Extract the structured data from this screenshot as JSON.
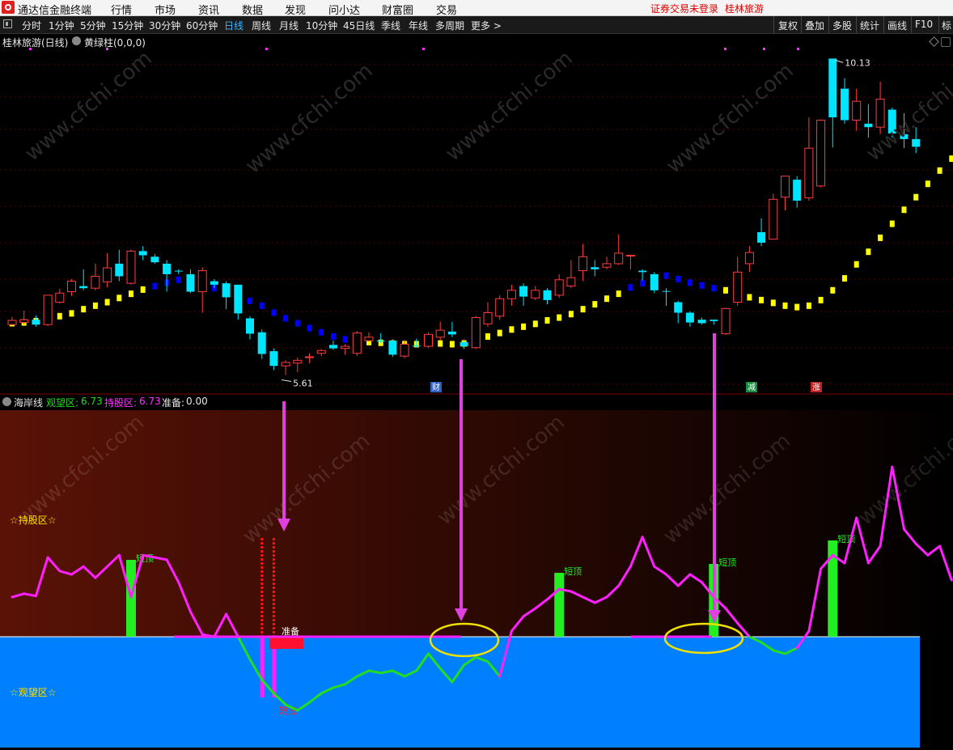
{
  "titlebar": {
    "app_name": "通达信金融终端",
    "menus": [
      "行情",
      "市场",
      "资讯",
      "数据",
      "发现",
      "问小达",
      "财富圈",
      "交易"
    ],
    "status_warning": "证券交易未登录",
    "stock": "桂林旅游"
  },
  "toolbar": {
    "periods": [
      "分时",
      "1分钟",
      "5分钟",
      "15分钟",
      "30分钟",
      "60分钟",
      "日线",
      "周线",
      "月线",
      "10分钟",
      "45日线",
      "季线",
      "年线",
      "多周期",
      "更多 >"
    ],
    "active_period": "日线",
    "right_buttons": [
      "复权",
      "叠加",
      "多股",
      "统计",
      "画线",
      "F10",
      "标"
    ]
  },
  "main_chart": {
    "title": "桂林旅游(日线)",
    "indicator": "黄绿柱(0,0,0)",
    "high_label": "10.13",
    "low_label": "5.61",
    "event_markers": [
      "财",
      "减",
      "涨"
    ]
  },
  "sub_chart": {
    "indicator_name": "海岸线",
    "watch_label": "观望区:",
    "watch_value": "6.73",
    "hold_label": "持股区:",
    "hold_value": "6.73",
    "ready_label": "准备:",
    "ready_value": "0.00",
    "zone_hold": "☆持股区☆",
    "zone_watch": "☆观望区☆",
    "short_top_labels": [
      "短顶",
      "短顶",
      "短顶",
      "短顶"
    ],
    "short_bottom_label": "短底",
    "ready_marker": "准备"
  },
  "chart_data": {
    "type": "candlestick",
    "candles": [
      [
        6.33,
        6.39,
        6.44,
        6.32
      ],
      [
        6.36,
        6.4,
        6.53,
        6.33
      ],
      [
        6.4,
        6.33,
        6.46,
        6.3
      ],
      [
        6.33,
        6.75,
        6.75,
        6.31
      ],
      [
        6.65,
        6.78,
        6.84,
        6.63
      ],
      [
        6.8,
        6.95,
        6.98,
        6.74
      ],
      [
        6.88,
        6.85,
        7.12,
        6.82
      ],
      [
        6.85,
        7.02,
        7.2,
        6.82
      ],
      [
        6.94,
        7.14,
        7.35,
        6.86
      ],
      [
        7.2,
        7.02,
        7.4,
        6.95
      ],
      [
        6.92,
        7.38,
        7.4,
        6.9
      ],
      [
        7.38,
        7.32,
        7.45,
        7.25
      ],
      [
        7.3,
        7.22,
        7.34,
        7.2
      ],
      [
        7.2,
        7.05,
        7.25,
        6.8
      ],
      [
        7.1,
        7.09,
        7.12,
        7.05
      ],
      [
        7.05,
        6.8,
        7.12,
        6.78
      ],
      [
        6.8,
        7.1,
        7.15,
        6.5
      ],
      [
        6.95,
        6.9,
        6.98,
        6.85
      ],
      [
        6.92,
        6.72,
        6.95,
        6.55
      ],
      [
        6.9,
        6.49,
        6.9,
        6.4
      ],
      [
        6.42,
        6.2,
        6.45,
        6.12
      ],
      [
        6.22,
        5.91,
        6.26,
        5.84
      ],
      [
        5.95,
        5.74,
        5.99,
        5.68
      ],
      [
        5.74,
        5.79,
        5.82,
        5.61
      ],
      [
        5.78,
        5.82,
        5.86,
        5.65
      ],
      [
        5.86,
        5.87,
        5.92,
        5.78
      ],
      [
        5.92,
        5.96,
        5.98,
        5.88
      ],
      [
        6.04,
        5.99,
        6.1,
        5.97
      ],
      [
        5.99,
        6.02,
        6.05,
        5.9
      ],
      [
        5.92,
        6.21,
        6.24,
        5.88
      ],
      [
        6.1,
        6.15,
        6.22,
        6.09
      ],
      [
        6.1,
        6.09,
        6.21,
        6.06
      ],
      [
        6.1,
        5.9,
        6.12,
        5.87
      ],
      [
        5.88,
        6.05,
        6.11,
        5.85
      ],
      [
        6.03,
        6.02,
        6.13,
        6.0
      ],
      [
        6.02,
        6.19,
        6.22,
        6.0
      ],
      [
        6.15,
        6.25,
        6.37,
        6.1
      ],
      [
        6.23,
        6.19,
        6.37,
        6.15
      ],
      [
        6.08,
        6.02,
        6.12,
        5.98
      ],
      [
        6.0,
        6.43,
        6.45,
        5.98
      ],
      [
        6.34,
        6.5,
        6.65,
        6.3
      ],
      [
        6.45,
        6.7,
        6.75,
        6.4
      ],
      [
        6.7,
        6.82,
        6.9,
        6.6
      ],
      [
        6.88,
        6.73,
        6.92,
        6.6
      ],
      [
        6.71,
        6.82,
        6.88,
        6.68
      ],
      [
        6.82,
        6.68,
        6.85,
        6.62
      ],
      [
        6.75,
        6.97,
        7.05,
        6.71
      ],
      [
        6.88,
        7.0,
        7.25,
        6.85
      ],
      [
        7.1,
        7.3,
        7.48,
        6.95
      ],
      [
        7.15,
        7.12,
        7.25,
        7.02
      ],
      [
        7.15,
        7.2,
        7.3,
        7.12
      ],
      [
        7.2,
        7.35,
        7.62,
        7.18
      ],
      [
        7.31,
        7.32,
        7.32,
        7.12
      ],
      [
        7.1,
        7.08,
        7.12,
        6.96
      ],
      [
        7.05,
        6.82,
        7.08,
        6.78
      ],
      [
        6.81,
        6.8,
        6.85,
        6.6
      ],
      [
        6.65,
        6.5,
        6.67,
        6.35
      ],
      [
        6.5,
        6.36,
        6.52,
        6.3
      ],
      [
        6.4,
        6.35,
        6.43,
        6.33
      ],
      [
        6.4,
        6.38,
        6.4,
        6.33
      ],
      [
        6.2,
        6.56,
        6.57,
        6.18
      ],
      [
        6.65,
        7.08,
        7.3,
        6.6
      ],
      [
        7.2,
        7.36,
        7.45,
        7.08
      ],
      [
        7.65,
        7.5,
        7.85,
        7.45
      ],
      [
        7.55,
        8.12,
        8.2,
        7.55
      ],
      [
        8.15,
        8.45,
        8.45,
        7.96
      ],
      [
        8.4,
        8.1,
        8.45,
        8.0
      ],
      [
        8.14,
        8.85,
        9.29,
        8.1
      ],
      [
        8.31,
        9.25,
        9.26,
        8.29
      ],
      [
        10.13,
        9.29,
        10.13,
        8.86
      ],
      [
        9.7,
        9.25,
        9.85,
        9.2
      ],
      [
        9.25,
        9.52,
        9.7,
        9.1
      ],
      [
        9.2,
        9.15,
        9.48,
        9.0
      ],
      [
        9.15,
        9.55,
        9.8,
        9.05
      ],
      [
        9.4,
        9.06,
        9.43,
        9.0
      ],
      [
        9.05,
        8.98,
        9.35,
        8.85
      ],
      [
        8.98,
        8.87,
        9.15,
        8.78
      ]
    ],
    "stop_line": [
      6.35,
      6.36,
      6.38,
      6.41,
      6.45,
      6.49,
      6.55,
      6.6,
      6.65,
      6.71,
      6.77,
      6.83,
      6.88,
      6.93,
      6.97,
      6.94,
      6.9,
      6.85,
      6.8,
      6.74,
      6.67,
      6.6,
      6.5,
      6.42,
      6.35,
      6.28,
      6.22,
      6.16,
      6.12,
      6.1,
      6.08,
      6.07,
      6.06,
      6.05,
      6.05,
      6.06,
      6.06,
      6.05,
      6.06,
      6.1,
      6.16,
      6.21,
      6.26,
      6.3,
      6.34,
      6.39,
      6.43,
      6.48,
      6.55,
      6.62,
      6.7,
      6.77,
      6.86,
      6.92,
      7.0,
      7.03,
      6.98,
      6.93,
      6.89,
      6.85,
      6.82,
      6.77,
      6.72,
      6.68,
      6.64,
      6.6,
      6.58,
      6.6,
      6.68,
      6.82,
      6.99,
      7.19,
      7.37,
      7.57,
      7.77,
      7.97,
      8.15,
      8.34,
      8.53,
      8.7
    ],
    "stop_line_up": [
      true,
      true,
      true,
      true,
      true,
      true,
      true,
      true,
      true,
      true,
      true,
      true,
      false,
      false,
      false,
      false,
      false,
      false,
      false,
      false,
      false,
      false,
      false,
      false,
      false,
      false,
      false,
      false,
      false,
      true,
      true,
      true,
      true,
      true,
      true,
      true,
      true,
      true,
      true,
      true,
      true,
      true,
      true,
      true,
      true,
      true,
      true,
      true,
      true,
      true,
      true,
      true,
      false,
      false,
      false,
      false,
      false,
      false,
      false,
      false,
      true,
      true,
      true,
      true,
      true,
      true,
      true,
      true,
      true,
      true,
      true,
      true,
      true,
      true,
      true,
      true,
      true,
      true,
      true,
      true
    ],
    "oscillator": [
      0.35,
      0.38,
      0.36,
      0.7,
      0.58,
      0.55,
      0.62,
      0.52,
      0.62,
      0.72,
      0.35,
      0.72,
      0.7,
      0.68,
      0.48,
      0.22,
      0.02,
      0.0,
      0.2,
      0.0,
      -0.2,
      -0.38,
      -0.5,
      -0.6,
      -0.65,
      -0.58,
      -0.5,
      -0.45,
      -0.42,
      -0.35,
      -0.3,
      -0.32,
      -0.3,
      -0.35,
      -0.3,
      -0.15,
      -0.28,
      -0.4,
      -0.25,
      -0.18,
      -0.22,
      -0.35,
      0.05,
      0.18,
      0.25,
      0.33,
      0.42,
      0.4,
      0.35,
      0.3,
      0.35,
      0.45,
      0.62,
      0.88,
      0.62,
      0.55,
      0.45,
      0.55,
      0.48,
      0.35,
      0.25,
      0.12,
      0.0,
      -0.05,
      -0.12,
      -0.15,
      -0.1,
      0.05,
      0.6,
      0.72,
      0.65,
      1.05,
      0.65,
      0.8,
      1.5,
      0.95,
      0.82,
      0.72,
      0.8,
      0.5
    ],
    "short_tops": [
      10,
      46,
      59,
      69
    ],
    "bottom_bars": [
      21,
      22
    ]
  },
  "colors": {
    "up": "#ff3c3c",
    "down": "#00e5ff",
    "stop_up": "#ffff00",
    "stop_down": "#0000ff",
    "osc_hold": "#ff20ff",
    "osc_watch": "#22dd22",
    "top_bar": "#22ee22",
    "watch_zone": "#0080ff",
    "hold_zone_from": "#5a1206",
    "hold_zone_to": "#000000",
    "arrow": "#e040e0",
    "ellipse": "#f0e000",
    "active_tab": "#3cb4ff"
  }
}
